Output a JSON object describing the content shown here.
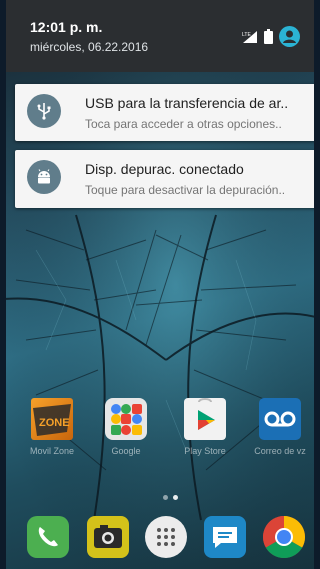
{
  "status": {
    "time": "12:01 p. m.",
    "date": "miércoles, 06.22.2016",
    "icons": [
      "signal-icon",
      "battery-icon",
      "user-avatar-icon"
    ]
  },
  "notifications": [
    {
      "icon": "usb-icon",
      "title": "USB para la transferencia de ar..",
      "subtitle": "Toca para acceder a otras opciones.."
    },
    {
      "icon": "android-icon",
      "title": "Disp. depurac. conectado",
      "subtitle": "Toque para desactivar la depuración.."
    }
  ],
  "apps": [
    {
      "label": "Movil Zone",
      "icon": "zone-icon",
      "icon_text": "ZONE",
      "color": "#e88a1a"
    },
    {
      "label": "Google",
      "icon": "google-folder-icon",
      "color": "#e8e8e8"
    },
    {
      "label": "Play Store",
      "icon": "play-store-icon",
      "color": "#f1f1f1"
    },
    {
      "label": "Correo de vz",
      "icon": "voicemail-icon",
      "color": "#1b6fb5"
    }
  ],
  "dock": [
    {
      "icon": "phone-icon",
      "color": "#4caf50"
    },
    {
      "icon": "camera-icon",
      "color": "#d4c21a"
    },
    {
      "icon": "app-drawer-icon",
      "color": "#e8e8e8"
    },
    {
      "icon": "messages-icon",
      "color": "#1e88c7"
    },
    {
      "icon": "chrome-icon",
      "color": "#ffffff"
    }
  ],
  "pager": {
    "pages": 2,
    "current": 2
  }
}
